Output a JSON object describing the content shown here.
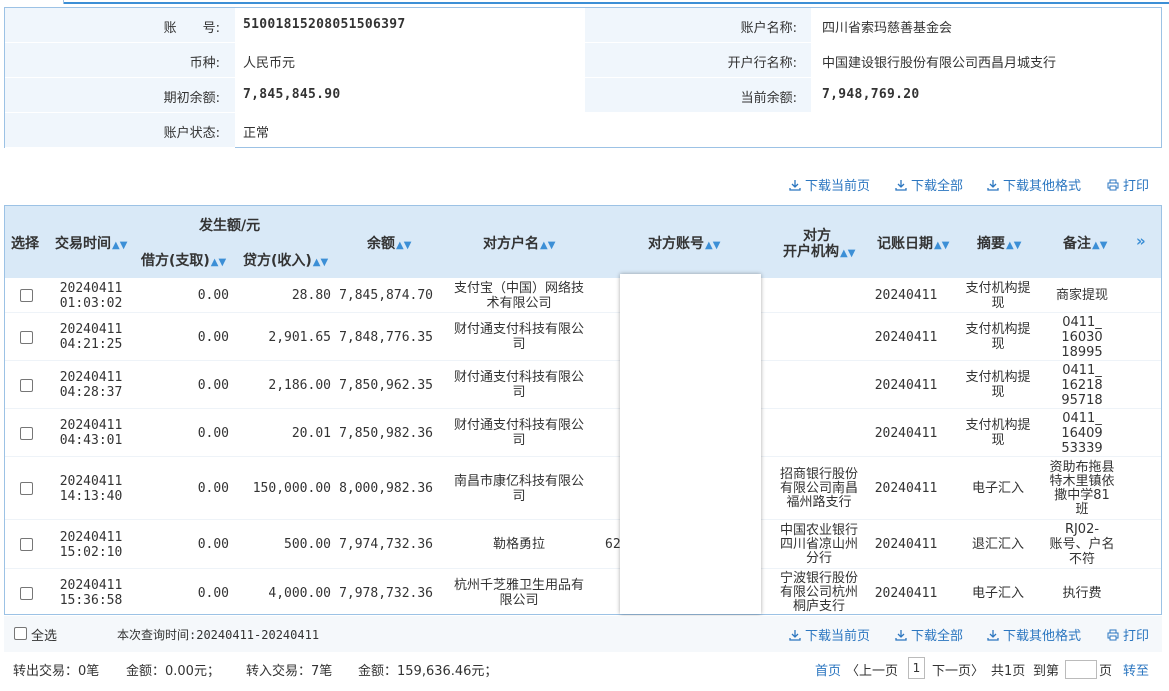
{
  "account": {
    "number_label": "账　　号:",
    "number": "51001815208051506397",
    "name_label": "账户名称:",
    "name": "四川省索玛慈善基金会",
    "currency_label": "币种:",
    "currency": "人民币元",
    "bank_label": "开户行名称:",
    "bank": "中国建设银行股份有限公司西昌月城支行",
    "opening_label": "期初余额:",
    "opening": "7,845,845.90",
    "current_label": "当前余额:",
    "current": "7,948,769.20",
    "status_label": "账户状态:",
    "status": "正常"
  },
  "toolbar": {
    "download_page": "下载当前页",
    "download_all": "下载全部",
    "download_other": "下载其他格式",
    "print": "打印"
  },
  "table": {
    "headers": {
      "select": "选择",
      "time": "交易时间",
      "amount_group": "发生额/元",
      "debit": "借方(支取)",
      "credit": "贷方(收入)",
      "balance": "余额",
      "counterparty_name": "对方户名",
      "counterparty_account": "对方账号",
      "counterparty_bank_1": "对方",
      "counterparty_bank_2": "开户机构",
      "post_date": "记账日期",
      "summary": "摘要",
      "remark": "备注",
      "more": "»"
    },
    "rows": [
      {
        "date": "20240411",
        "time": "01:03:02",
        "debit": "0.00",
        "credit": "28.80",
        "balance": "7,845,874.70",
        "name": [
          "支付宝（中国）网络技",
          "术有限公司"
        ],
        "account": "",
        "bank": [],
        "post_date": "20240411",
        "summary": [
          "支付机构提",
          "现"
        ],
        "remark": [
          "商家提现"
        ]
      },
      {
        "date": "20240411",
        "time": "04:21:25",
        "debit": "0.00",
        "credit": "2,901.65",
        "balance": "7,848,776.35",
        "name": [
          "财付通支付科技有限公",
          "司"
        ],
        "account": "",
        "bank": [],
        "post_date": "20240411",
        "summary": [
          "支付机构提",
          "现"
        ],
        "remark": [
          "0411_",
          "16030",
          "18995"
        ]
      },
      {
        "date": "20240411",
        "time": "04:28:37",
        "debit": "0.00",
        "credit": "2,186.00",
        "balance": "7,850,962.35",
        "name": [
          "财付通支付科技有限公",
          "司"
        ],
        "account": "",
        "bank": [],
        "post_date": "20240411",
        "summary": [
          "支付机构提",
          "现"
        ],
        "remark": [
          "0411_",
          "16218",
          "95718"
        ]
      },
      {
        "date": "20240411",
        "time": "04:43:01",
        "debit": "0.00",
        "credit": "20.01",
        "balance": "7,850,982.36",
        "name": [
          "财付通支付科技有限公",
          "司"
        ],
        "account": "",
        "bank": [],
        "post_date": "20240411",
        "summary": [
          "支付机构提",
          "现"
        ],
        "remark": [
          "0411_",
          "16409",
          "53339"
        ]
      },
      {
        "date": "20240411",
        "time": "14:13:40",
        "debit": "0.00",
        "credit": "150,000.00",
        "balance": "8,000,982.36",
        "name": [
          "南昌市康亿科技有限公",
          "司"
        ],
        "account": "",
        "bank": [
          "招商银行股份",
          "有限公司南昌",
          "福州路支行"
        ],
        "post_date": "20240411",
        "summary": [
          "电子汇入"
        ],
        "remark": [
          "资助布拖县",
          "特木里镇依",
          "撒中学81",
          "班"
        ]
      },
      {
        "date": "20240411",
        "time": "15:02:10",
        "debit": "0.00",
        "credit": "500.00",
        "balance": "7,974,732.36",
        "name": [
          "勒格勇拉"
        ],
        "account": "62",
        "bank": [
          "中国农业银行",
          "四川省凉山州",
          "分行"
        ],
        "post_date": "20240411",
        "summary": [
          "退汇汇入"
        ],
        "remark": [
          "RJ02-",
          "账号、户名",
          "不符"
        ]
      },
      {
        "date": "20240411",
        "time": "15:36:58",
        "debit": "0.00",
        "credit": "4,000.00",
        "balance": "7,978,732.36",
        "name": [
          "杭州千芝雅卫生用品有",
          "限公司"
        ],
        "account": "",
        "bank": [
          "宁波银行股份",
          "有限公司杭州",
          "桐庐支行"
        ],
        "post_date": "20240411",
        "summary": [
          "电子汇入"
        ],
        "remark": [
          "执行费"
        ]
      }
    ]
  },
  "footer": {
    "select_all": "全选",
    "query_time": "本次查询时间:20240411-20240411",
    "out_count": "转出交易：0笔",
    "out_amount": "金额：0.00元；",
    "in_count": "转入交易：7笔",
    "in_amount": "金额：159,636.46元；",
    "first": "首页",
    "prev": "〈上一页",
    "page": "1",
    "next": "下一页〉",
    "total": "共1页",
    "goto": "到第",
    "page_unit": "页",
    "go": "转至"
  },
  "colors": {
    "accent": "#3c8fd6",
    "link": "#2b76c0",
    "header_bg": "#d9e9f7",
    "label_bg": "#f0f6fc"
  }
}
